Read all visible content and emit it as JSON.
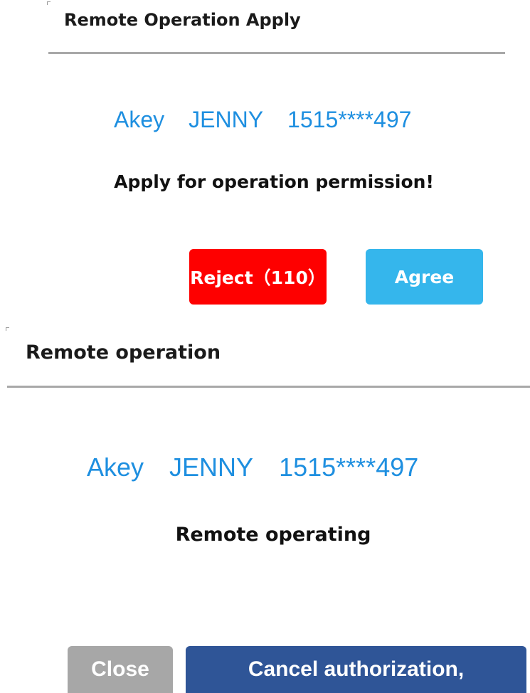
{
  "apply_dialog": {
    "title": "Remote Operation Apply",
    "user": {
      "name": "Akey",
      "alias": "JENNY",
      "phone": "1515****497"
    },
    "message": "Apply for operation permission!",
    "reject_label": "Reject（110）",
    "agree_label": "Agree",
    "colors": {
      "reject": "#fe0000",
      "agree": "#35b6ec",
      "user_text": "#1e8fe0"
    }
  },
  "operation_dialog": {
    "title": "Remote operation",
    "user": {
      "name": "Akey",
      "alias": "JENNY",
      "phone": "1515****497"
    },
    "message": "Remote operating",
    "close_label": "Close",
    "cancel_label": "Cancel authorization,",
    "colors": {
      "close": "#a7a7a7",
      "cancel": "#2f5597",
      "user_text": "#1e8fe0"
    }
  }
}
